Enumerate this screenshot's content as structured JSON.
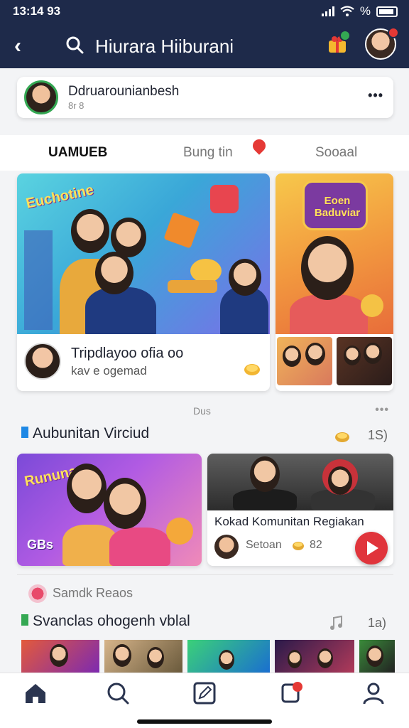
{
  "status": {
    "time": "13:14 93",
    "signal": "%"
  },
  "header": {
    "title": "Hiurara Hiiburani",
    "back_icon": "chevron-left-icon",
    "search_icon": "search-icon"
  },
  "profile": {
    "name": "Ddruarounianbesh",
    "sub": "8r 8",
    "more": "•••"
  },
  "tabs": [
    {
      "label": "UAMUEB",
      "active": true
    },
    {
      "label": "Bung tin",
      "active": false
    },
    {
      "label": "Sooaal",
      "active": false
    }
  ],
  "feature": {
    "main_image_text": "Euchotine",
    "main_title": "Tripdlayoo ofia oo",
    "main_sub": "kav e ogemad",
    "side_image_text": "Eoen Baduviar",
    "divider_label": "Dus"
  },
  "section1": {
    "title": "Aubunitan Virciud",
    "count": "1S)",
    "card1_image_text": "Rununan",
    "card1_caption": "GBs",
    "card2_title": "Kokad Komunitan Regiakan",
    "card2_meta": "Setoan",
    "card2_count": "82"
  },
  "section2": {
    "kicker": "Samdk Reaos",
    "title": "Svanclas ohogenh vblal",
    "count": "1a)"
  },
  "nav": [
    {
      "name": "home-icon"
    },
    {
      "name": "search-icon"
    },
    {
      "name": "edit-icon"
    },
    {
      "name": "notification-icon"
    },
    {
      "name": "profile-icon"
    }
  ],
  "colors": {
    "header": "#1e2a4a",
    "accent_red": "#e0343b",
    "accent_green": "#34a853"
  }
}
